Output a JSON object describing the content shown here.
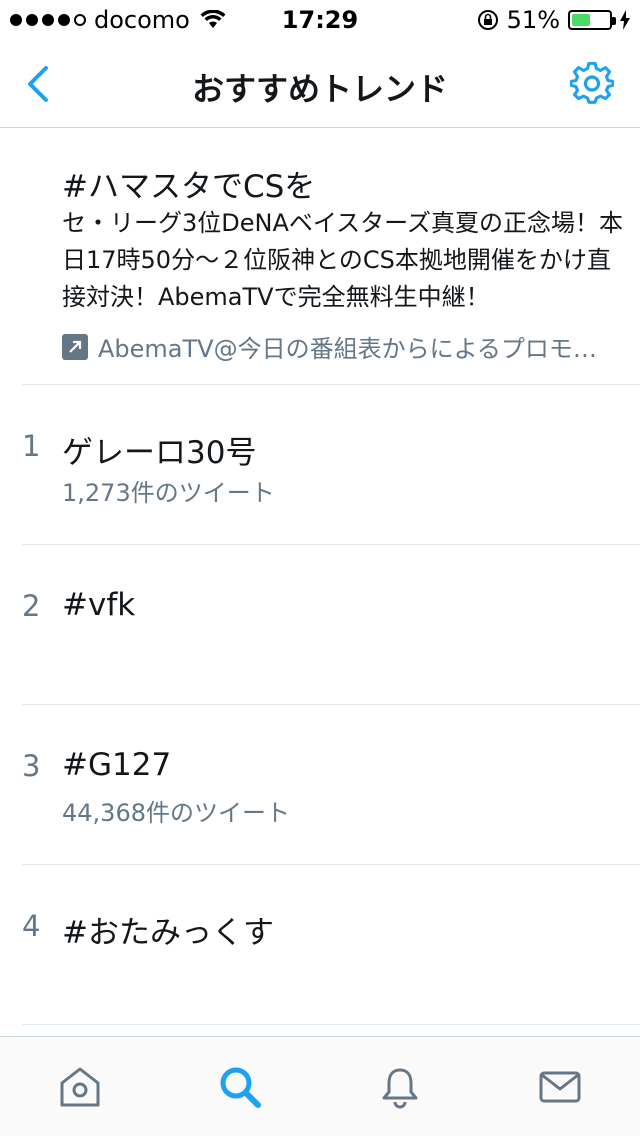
{
  "status_bar": {
    "carrier": "docomo",
    "time": "17:29",
    "battery_percent_text": "51%",
    "battery_level": 0.51,
    "signal_bars_filled": 4,
    "signal_bars_total": 5
  },
  "nav": {
    "title": "おすすめトレンド",
    "back_icon": "chevron-left-icon",
    "settings_icon": "gear-icon",
    "accent_color": "#1da1f2"
  },
  "promoted": {
    "title": "#ハマスタでCSを",
    "description": "セ・リーグ3位DeNAベイスターズ真夏の正念場！本日17時50分～２位阪神とのCS本拠地開催をかけ直接対決！AbemaTVで完全無料生中継！",
    "source": "AbemaTVAbemaTV@今日の番組表からによるプロモ…",
    "source_display": "AbemaTV@今日の番組表からによるプロモ…",
    "icon": "promoted-arrow-icon"
  },
  "trends": [
    {
      "rank": "1",
      "name": "ゲレーロ30号",
      "count": "1,273件のツイート"
    },
    {
      "rank": "2",
      "name": "#vfk",
      "count": ""
    },
    {
      "rank": "3",
      "name": "#G127",
      "count": "44,368件のツイート"
    },
    {
      "rank": "4",
      "name": "#おたみっくす",
      "count": ""
    }
  ],
  "tab_bar": {
    "items": [
      "home-icon",
      "search-icon",
      "bell-icon",
      "mail-icon"
    ],
    "active": "search-icon",
    "active_color": "#1da1f2",
    "inactive_color": "#657786"
  }
}
